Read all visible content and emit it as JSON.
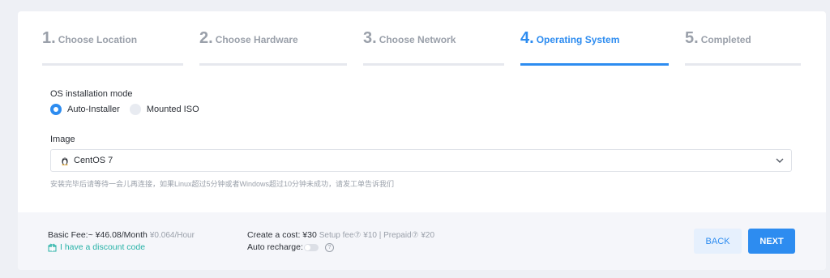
{
  "steps": [
    {
      "num": "1.",
      "label": "Choose Location"
    },
    {
      "num": "2.",
      "label": "Choose Hardware"
    },
    {
      "num": "3.",
      "label": "Choose Network"
    },
    {
      "num": "4.",
      "label": "Operating System"
    },
    {
      "num": "5.",
      "label": "Completed"
    }
  ],
  "active_step": 4,
  "os_mode": {
    "label": "OS installation mode",
    "options": [
      "Auto-Installer",
      "Mounted ISO"
    ],
    "selected": "Auto-Installer"
  },
  "image": {
    "label": "Image",
    "selected": "CentOS 7",
    "icon": "tux-icon",
    "hint": "安装完毕后请等待一会儿再连接，如果Linux超过5分钟或者Windows超过10分钟未成功，请发工单告诉我们"
  },
  "footer": {
    "basic_fee": "Basic Fee:~ ¥46.08/Month",
    "basic_fee_hourly": "¥0.064/Hour",
    "discount_link": "I have a discount code",
    "create_cost": "Create a cost:  ¥30",
    "create_cost_detail": "Setup fee⑦ ¥10 | Prepaid⑦ ¥20",
    "auto_recharge": "Auto recharge:",
    "auto_recharge_on": false,
    "help_glyph": "?",
    "back_label": "BACK",
    "next_label": "NEXT"
  },
  "colors": {
    "accent": "#2d8cf0",
    "link": "#27b2a7",
    "muted": "#9aa0aa"
  }
}
